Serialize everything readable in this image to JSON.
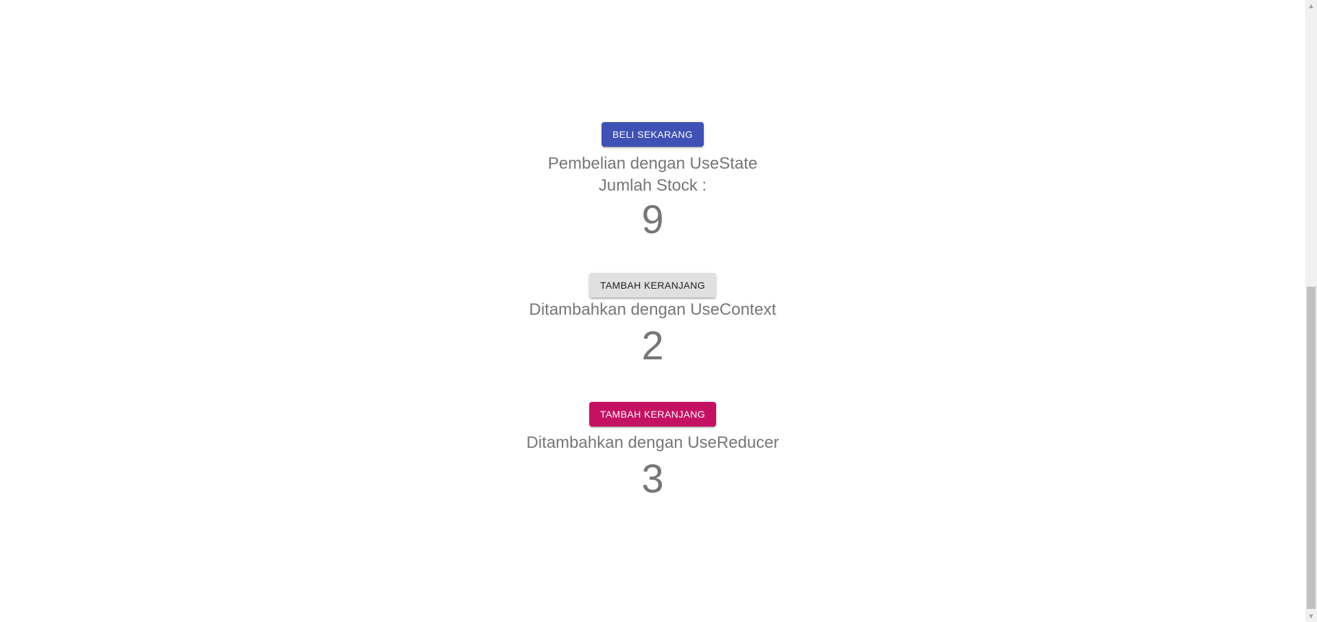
{
  "usestate": {
    "button_label": "BELI SEKARANG",
    "title": "Pembelian dengan UseState",
    "stock_label": "Jumlah Stock :",
    "stock_value": "9"
  },
  "usecontext": {
    "button_label": "TAMBAH KERANJANG",
    "title": "Ditambahkan dengan UseContext",
    "value": "2"
  },
  "usereducer": {
    "button_label": "TAMBAH KERANJANG",
    "title": "Ditambahkan dengan UseReducer",
    "value": "3"
  },
  "colors": {
    "primary": "#3f51b5",
    "default": "#e0e0e0",
    "secondary": "#c51162",
    "text": "#767676"
  }
}
